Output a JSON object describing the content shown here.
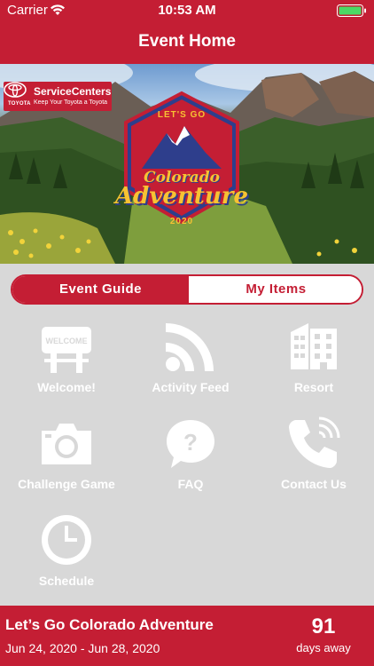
{
  "status_bar": {
    "carrier": "Carrier",
    "time": "10:53 AM"
  },
  "nav": {
    "title": "Event Home"
  },
  "hero": {
    "badge": {
      "brand": "TOYOTA",
      "title": "ServiceCenters",
      "tagline": "Keep Your Toyota a Toyota"
    },
    "logo": {
      "top": "LET'S GO",
      "line1": "Colorado",
      "line2": "Adventure",
      "year": "2020"
    }
  },
  "segment": {
    "left": "Event Guide",
    "right": "My Items"
  },
  "tiles": [
    {
      "label": "Welcome!",
      "icon": "welcome-sign-icon",
      "sign_text": "WELCOME"
    },
    {
      "label": "Activity Feed",
      "icon": "rss-feed-icon"
    },
    {
      "label": "Resort",
      "icon": "building-icon"
    },
    {
      "label": "Challenge Game",
      "icon": "camera-icon"
    },
    {
      "label": "FAQ",
      "icon": "question-bubble-icon",
      "glyph": "?"
    },
    {
      "label": "Contact Us",
      "icon": "phone-icon"
    },
    {
      "label": "Schedule",
      "icon": "clock-icon"
    }
  ],
  "footer": {
    "event_name": "Let’s Go Colorado Adventure",
    "dates": "Jun 24, 2020 - Jun 28, 2020",
    "days_count": "91",
    "days_label": "days away"
  },
  "colors": {
    "brand_red": "#c41e34",
    "background": "#d8d8d8",
    "tile_white": "#ffffff"
  }
}
